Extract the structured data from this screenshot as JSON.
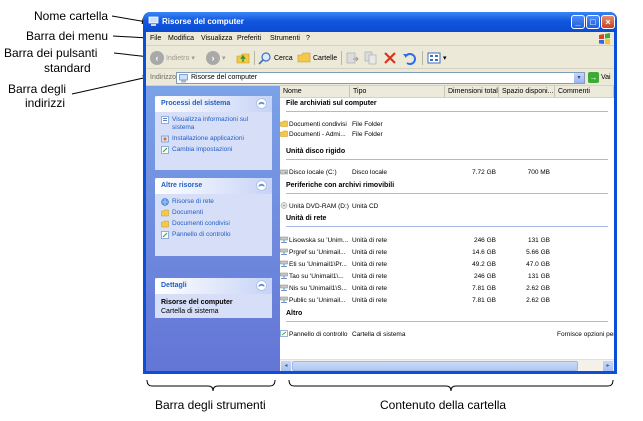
{
  "annotations": {
    "nome_cartella": "Nome cartella",
    "barra_menu": "Barra dei menu",
    "barra_pulsanti_1": "Barra dei pulsanti",
    "barra_pulsanti_2": "standard",
    "barra_indirizzi_1": "Barra degli",
    "barra_indirizzi_2": "indirizzi",
    "barra_strumenti": "Barra degli strumenti",
    "contenuto_cartella": "Contenuto della cartella"
  },
  "window": {
    "title": "Risorse del computer",
    "controls": {
      "minimize": "_",
      "maximize": "□",
      "close": "×"
    }
  },
  "menu": {
    "items": [
      "File",
      "Modifica",
      "Visualizza",
      "Preferiti",
      "Strumenti",
      "?"
    ]
  },
  "toolbar": {
    "back_label": "Indietro",
    "search_label": "Cerca",
    "folders_label": "Cartelle"
  },
  "address": {
    "label": "Indirizzo",
    "value": "Risorse del computer",
    "go_label": "Vai"
  },
  "taskpane": {
    "system": {
      "title": "Processi del sistema",
      "links": [
        "Visualizza informazioni sul sistema",
        "Installazione applicazioni",
        "Cambia impostazioni"
      ]
    },
    "other": {
      "title": "Altre risorse",
      "links": [
        "Risorse di rete",
        "Documenti",
        "Documenti condivisi",
        "Pannello di controllo"
      ]
    },
    "details": {
      "title": "Dettagli",
      "name": "Risorse del computer",
      "type": "Cartella di sistema"
    }
  },
  "columns": [
    "Nome",
    "Tipo",
    "Dimensioni totali",
    "Spazio disponi...",
    "Commenti"
  ],
  "groups": [
    {
      "title": "File archiviati sul computer",
      "rows": [
        {
          "name": "Documenti condivisi",
          "type": "File Folder",
          "total": "",
          "free": "",
          "comment": ""
        },
        {
          "name": "Documenti - Admi...",
          "type": "File Folder",
          "total": "",
          "free": "",
          "comment": ""
        }
      ]
    },
    {
      "title": "Unità disco rigido",
      "rows": [
        {
          "name": "Disco locale (C:)",
          "type": "Disco locale",
          "total": "7.72 GB",
          "free": "700 MB",
          "comment": ""
        }
      ]
    },
    {
      "title": "Periferiche con archivi rimovibili",
      "rows": [
        {
          "name": "Unità DVD-RAM (D:)",
          "type": "Unità CD",
          "total": "",
          "free": "",
          "comment": ""
        }
      ]
    },
    {
      "title": "Unità di rete",
      "rows": [
        {
          "name": "Lisowska su 'Unim...",
          "type": "Unità di rete",
          "total": "246 GB",
          "free": "131 GB",
          "comment": ""
        },
        {
          "name": "Prgref su 'Unimail...",
          "type": "Unità di rete",
          "total": "14.6 GB",
          "free": "5.66 GB",
          "comment": ""
        },
        {
          "name": "Eti su 'Unimail1\\Pr...",
          "type": "Unità di rete",
          "total": "49.2 GB",
          "free": "47.0 GB",
          "comment": ""
        },
        {
          "name": "Tao su 'Unimail1\\...",
          "type": "Unità di rete",
          "total": "246 GB",
          "free": "131 GB",
          "comment": ""
        },
        {
          "name": "Nis su 'Unimail1\\S...",
          "type": "Unità di rete",
          "total": "7.81 GB",
          "free": "2.62 GB",
          "comment": ""
        },
        {
          "name": "Public su 'Unimail...",
          "type": "Unità di rete",
          "total": "7.81 GB",
          "free": "2.62 GB",
          "comment": ""
        }
      ]
    },
    {
      "title": "Altro",
      "rows": [
        {
          "name": "Pannello di controllo",
          "type": "Cartella di sistema",
          "total": "",
          "free": "",
          "comment": "Fornisce opzioni per"
        }
      ]
    }
  ]
}
